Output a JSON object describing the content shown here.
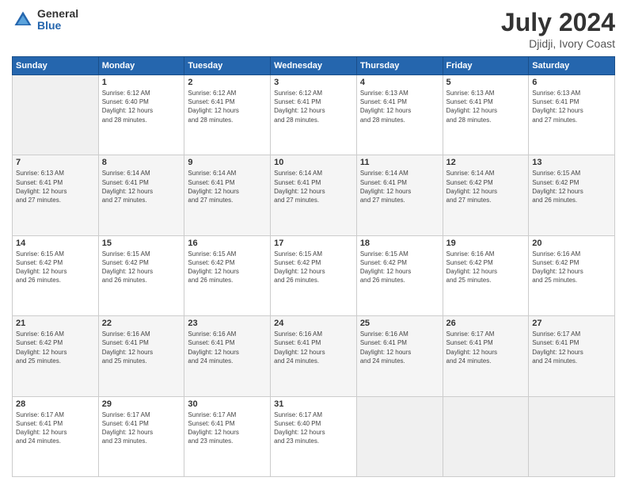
{
  "header": {
    "logo_general": "General",
    "logo_blue": "Blue",
    "title": "July 2024",
    "location": "Djidji, Ivory Coast"
  },
  "days_of_week": [
    "Sunday",
    "Monday",
    "Tuesday",
    "Wednesday",
    "Thursday",
    "Friday",
    "Saturday"
  ],
  "weeks": [
    [
      {
        "day": "",
        "info": ""
      },
      {
        "day": "1",
        "info": "Sunrise: 6:12 AM\nSunset: 6:40 PM\nDaylight: 12 hours\nand 28 minutes."
      },
      {
        "day": "2",
        "info": "Sunrise: 6:12 AM\nSunset: 6:41 PM\nDaylight: 12 hours\nand 28 minutes."
      },
      {
        "day": "3",
        "info": "Sunrise: 6:12 AM\nSunset: 6:41 PM\nDaylight: 12 hours\nand 28 minutes."
      },
      {
        "day": "4",
        "info": "Sunrise: 6:13 AM\nSunset: 6:41 PM\nDaylight: 12 hours\nand 28 minutes."
      },
      {
        "day": "5",
        "info": "Sunrise: 6:13 AM\nSunset: 6:41 PM\nDaylight: 12 hours\nand 28 minutes."
      },
      {
        "day": "6",
        "info": "Sunrise: 6:13 AM\nSunset: 6:41 PM\nDaylight: 12 hours\nand 27 minutes."
      }
    ],
    [
      {
        "day": "7",
        "info": "Sunrise: 6:13 AM\nSunset: 6:41 PM\nDaylight: 12 hours\nand 27 minutes."
      },
      {
        "day": "8",
        "info": "Sunrise: 6:14 AM\nSunset: 6:41 PM\nDaylight: 12 hours\nand 27 minutes."
      },
      {
        "day": "9",
        "info": "Sunrise: 6:14 AM\nSunset: 6:41 PM\nDaylight: 12 hours\nand 27 minutes."
      },
      {
        "day": "10",
        "info": "Sunrise: 6:14 AM\nSunset: 6:41 PM\nDaylight: 12 hours\nand 27 minutes."
      },
      {
        "day": "11",
        "info": "Sunrise: 6:14 AM\nSunset: 6:41 PM\nDaylight: 12 hours\nand 27 minutes."
      },
      {
        "day": "12",
        "info": "Sunrise: 6:14 AM\nSunset: 6:42 PM\nDaylight: 12 hours\nand 27 minutes."
      },
      {
        "day": "13",
        "info": "Sunrise: 6:15 AM\nSunset: 6:42 PM\nDaylight: 12 hours\nand 26 minutes."
      }
    ],
    [
      {
        "day": "14",
        "info": "Sunrise: 6:15 AM\nSunset: 6:42 PM\nDaylight: 12 hours\nand 26 minutes."
      },
      {
        "day": "15",
        "info": "Sunrise: 6:15 AM\nSunset: 6:42 PM\nDaylight: 12 hours\nand 26 minutes."
      },
      {
        "day": "16",
        "info": "Sunrise: 6:15 AM\nSunset: 6:42 PM\nDaylight: 12 hours\nand 26 minutes."
      },
      {
        "day": "17",
        "info": "Sunrise: 6:15 AM\nSunset: 6:42 PM\nDaylight: 12 hours\nand 26 minutes."
      },
      {
        "day": "18",
        "info": "Sunrise: 6:15 AM\nSunset: 6:42 PM\nDaylight: 12 hours\nand 26 minutes."
      },
      {
        "day": "19",
        "info": "Sunrise: 6:16 AM\nSunset: 6:42 PM\nDaylight: 12 hours\nand 25 minutes."
      },
      {
        "day": "20",
        "info": "Sunrise: 6:16 AM\nSunset: 6:42 PM\nDaylight: 12 hours\nand 25 minutes."
      }
    ],
    [
      {
        "day": "21",
        "info": "Sunrise: 6:16 AM\nSunset: 6:42 PM\nDaylight: 12 hours\nand 25 minutes."
      },
      {
        "day": "22",
        "info": "Sunrise: 6:16 AM\nSunset: 6:41 PM\nDaylight: 12 hours\nand 25 minutes."
      },
      {
        "day": "23",
        "info": "Sunrise: 6:16 AM\nSunset: 6:41 PM\nDaylight: 12 hours\nand 24 minutes."
      },
      {
        "day": "24",
        "info": "Sunrise: 6:16 AM\nSunset: 6:41 PM\nDaylight: 12 hours\nand 24 minutes."
      },
      {
        "day": "25",
        "info": "Sunrise: 6:16 AM\nSunset: 6:41 PM\nDaylight: 12 hours\nand 24 minutes."
      },
      {
        "day": "26",
        "info": "Sunrise: 6:17 AM\nSunset: 6:41 PM\nDaylight: 12 hours\nand 24 minutes."
      },
      {
        "day": "27",
        "info": "Sunrise: 6:17 AM\nSunset: 6:41 PM\nDaylight: 12 hours\nand 24 minutes."
      }
    ],
    [
      {
        "day": "28",
        "info": "Sunrise: 6:17 AM\nSunset: 6:41 PM\nDaylight: 12 hours\nand 24 minutes."
      },
      {
        "day": "29",
        "info": "Sunrise: 6:17 AM\nSunset: 6:41 PM\nDaylight: 12 hours\nand 23 minutes."
      },
      {
        "day": "30",
        "info": "Sunrise: 6:17 AM\nSunset: 6:41 PM\nDaylight: 12 hours\nand 23 minutes."
      },
      {
        "day": "31",
        "info": "Sunrise: 6:17 AM\nSunset: 6:40 PM\nDaylight: 12 hours\nand 23 minutes."
      },
      {
        "day": "",
        "info": ""
      },
      {
        "day": "",
        "info": ""
      },
      {
        "day": "",
        "info": ""
      }
    ]
  ]
}
